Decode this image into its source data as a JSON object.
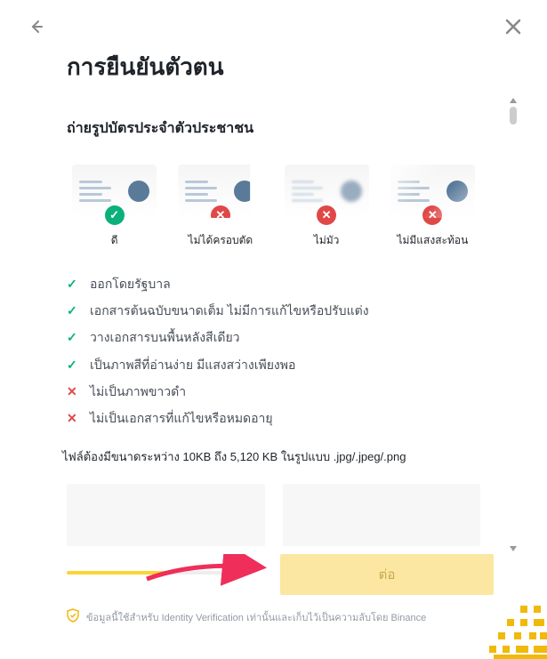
{
  "title": "การยืนยันตัวตน",
  "subtitle": "ถ่ายรูปบัตรประจำตัวประชาชน",
  "examples": [
    {
      "label": "ดี",
      "status": "good"
    },
    {
      "label": "ไม่ได้ครอบตัด",
      "status": "bad"
    },
    {
      "label": "ไม่มัว",
      "status": "bad"
    },
    {
      "label": "ไม่มีแสงสะท้อน",
      "status": "bad"
    }
  ],
  "checklist": [
    {
      "ok": true,
      "text": "ออกโดยรัฐบาล"
    },
    {
      "ok": true,
      "text": "เอกสารต้นฉบับขนาดเต็ม ไม่มีการแก้ไขหรือปรับแต่ง"
    },
    {
      "ok": true,
      "text": "วางเอกสารบนพื้นหลังสีเดียว"
    },
    {
      "ok": true,
      "text": "เป็นภาพสีที่อ่านง่าย มีแสงสว่างเพียงพอ"
    },
    {
      "ok": false,
      "text": "ไม่เป็นภาพขาวดำ"
    },
    {
      "ok": false,
      "text": "ไม่เป็นเอกสารที่แก้ไขหรือหมดอายุ"
    }
  ],
  "file_note": "ไฟล์ต้องมีขนาดระหว่าง 10KB ถึง 5,120 KB ในรูปแบบ .jpg/.jpeg/.png",
  "continue_label": "ต่อ",
  "privacy_text": "ข้อมูลนี้ใช้สำหรับ Identity Verification เท่านั้นและเก็บไว้เป็นความลับโดย Binance"
}
